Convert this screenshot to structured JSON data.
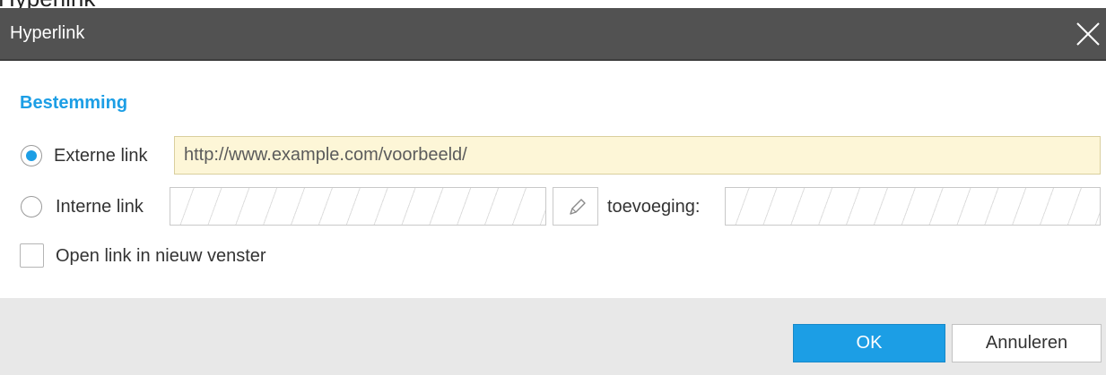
{
  "window": {
    "top_fragment": "Hyperlink",
    "title": "Hyperlink",
    "close_icon": "close-icon"
  },
  "destination": {
    "section_title": "Bestemming",
    "external": {
      "label": "Externe link",
      "selected": true,
      "value": "http://www.example.com/voorbeeld/"
    },
    "internal": {
      "label": "Interne link",
      "selected": false,
      "value": "",
      "edit_icon": "pencil-icon",
      "addition_label": "toevoeging:",
      "addition_value": ""
    },
    "new_window": {
      "label": "Open link in nieuw venster",
      "checked": false
    }
  },
  "footer": {
    "ok_label": "OK",
    "cancel_label": "Annuleren"
  },
  "colors": {
    "accent": "#1c9ee5",
    "titlebar": "#525252",
    "footer": "#e8e8e8",
    "url_field": "#fdf6d7"
  }
}
